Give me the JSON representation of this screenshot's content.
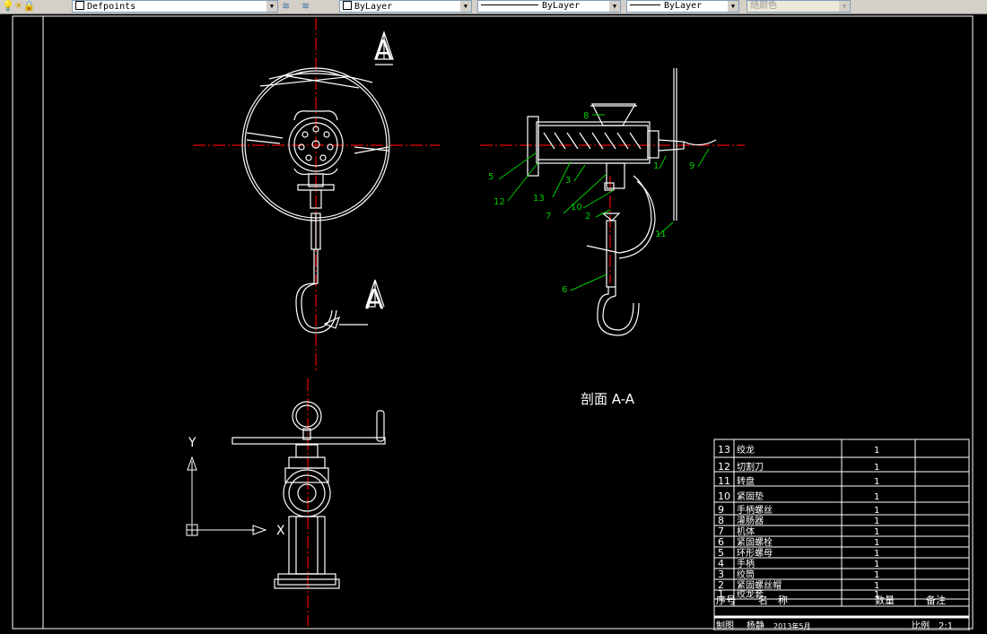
{
  "toolbar": {
    "layer_name": "Defpoints",
    "color_value": "ByLayer",
    "linetype_value": "ByLayer",
    "lineweight_value": "ByLayer",
    "plotstyle_value": "随颜色"
  },
  "drawing": {
    "view_marker_top": "A",
    "view_marker_bottom": "A",
    "section_title": "剖面 A-A",
    "ucs_y": "Y",
    "ucs_x": "X",
    "part_callouts": [
      "5",
      "12",
      "13",
      "3",
      "7",
      "10",
      "2",
      "6",
      "11",
      "1",
      "9",
      "8"
    ]
  },
  "bom": {
    "rows": [
      {
        "no": "13",
        "name": "绞龙",
        "qty": "1"
      },
      {
        "no": "12",
        "name": "切割刀",
        "qty": "1"
      },
      {
        "no": "11",
        "name": "转盘",
        "qty": "1"
      },
      {
        "no": "10",
        "name": "紧固垫",
        "qty": "1"
      },
      {
        "no": "9",
        "name": "手柄螺丝",
        "qty": "1"
      },
      {
        "no": "8",
        "name": "灌肠器",
        "qty": "1"
      },
      {
        "no": "7",
        "name": "机体",
        "qty": "1"
      },
      {
        "no": "6",
        "name": "紧固螺栓",
        "qty": "1"
      },
      {
        "no": "5",
        "name": "环形螺母",
        "qty": "1"
      },
      {
        "no": "4",
        "name": "手柄",
        "qty": "1"
      },
      {
        "no": "3",
        "name": "绞筒",
        "qty": "1"
      },
      {
        "no": "2",
        "name": "紧固螺丝帽",
        "qty": "1"
      },
      {
        "no": "1",
        "name": "绞龙套",
        "qty": "1"
      }
    ],
    "header": {
      "no": "序号",
      "name": "名　称",
      "qty": "数量",
      "note": "备注"
    },
    "footer": {
      "drawn_label": "制图",
      "drawer": "杨静",
      "date": "2013年5月",
      "scale_label": "比例",
      "scale_value": "2:1"
    }
  }
}
